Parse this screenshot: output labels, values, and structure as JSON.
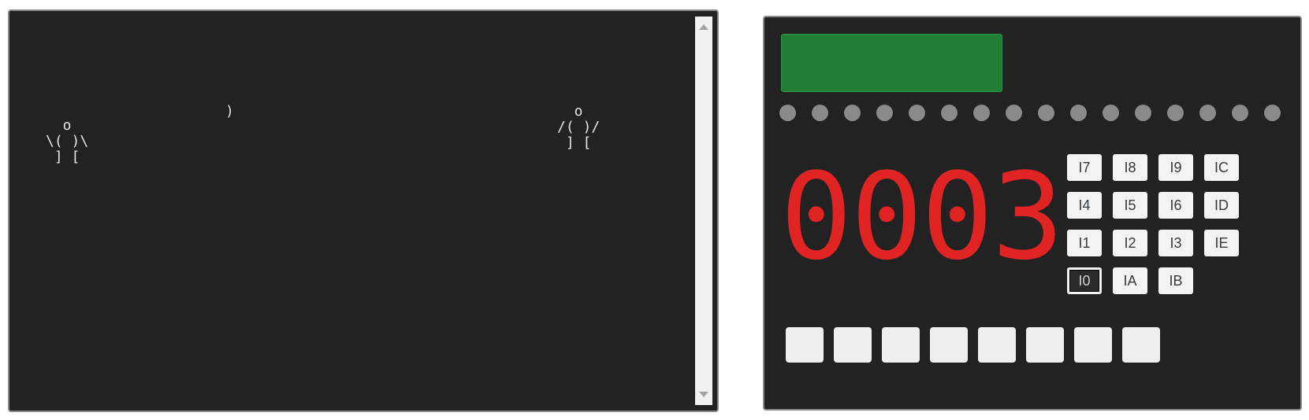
{
  "terminal": {
    "figure_left": [
      "  o",
      "\\( )\\",
      " ] ["
    ],
    "projectile": ")",
    "figure_right": [
      "  o",
      "/( )/",
      " ] ["
    ]
  },
  "device": {
    "display_color": "#217f35",
    "led_count": 16,
    "counter": "0003",
    "counter_color": "#e02424",
    "keypad": {
      "rows": [
        [
          "I7",
          "I8",
          "I9",
          "IC"
        ],
        [
          "I4",
          "I5",
          "I6",
          "ID"
        ],
        [
          "I1",
          "I2",
          "I3",
          "IE"
        ],
        [
          "I0",
          "IA",
          "IB"
        ]
      ],
      "focused_key": "I0"
    },
    "switch_count": 8
  }
}
